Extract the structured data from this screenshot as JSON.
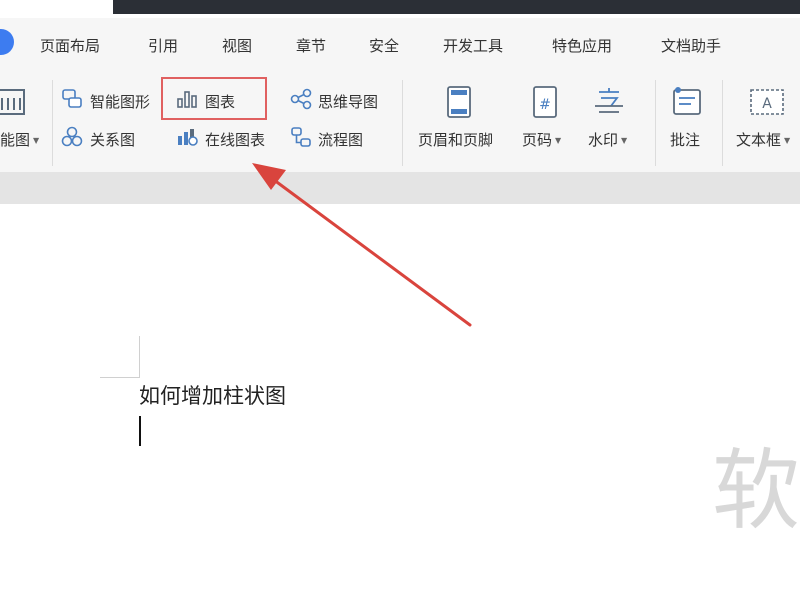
{
  "menu": {
    "tabs": [
      "页面布局",
      "引用",
      "视图",
      "章节",
      "安全",
      "开发工具",
      "特色应用",
      "文档助手"
    ]
  },
  "ribbon": {
    "smart_graphic_partial": "能图",
    "smart_shape": "智能图形",
    "relation_chart": "关系图",
    "chart": "图表",
    "online_chart": "在线图表",
    "mind_map": "思维导图",
    "flowchart": "流程图",
    "header_footer": "页眉和页脚",
    "page_number": "页码",
    "watermark": "水印",
    "comment": "批注",
    "text_box": "文本框",
    "page_number_glyph": "#",
    "text_box_glyph": "A"
  },
  "document": {
    "line1": "如何增加柱状图",
    "watermark_text": "软"
  },
  "colors": {
    "accent": "#3d7cf0",
    "highlight": "#e06060",
    "arrow": "#d9443d",
    "titlebar": "#2b2f36"
  }
}
